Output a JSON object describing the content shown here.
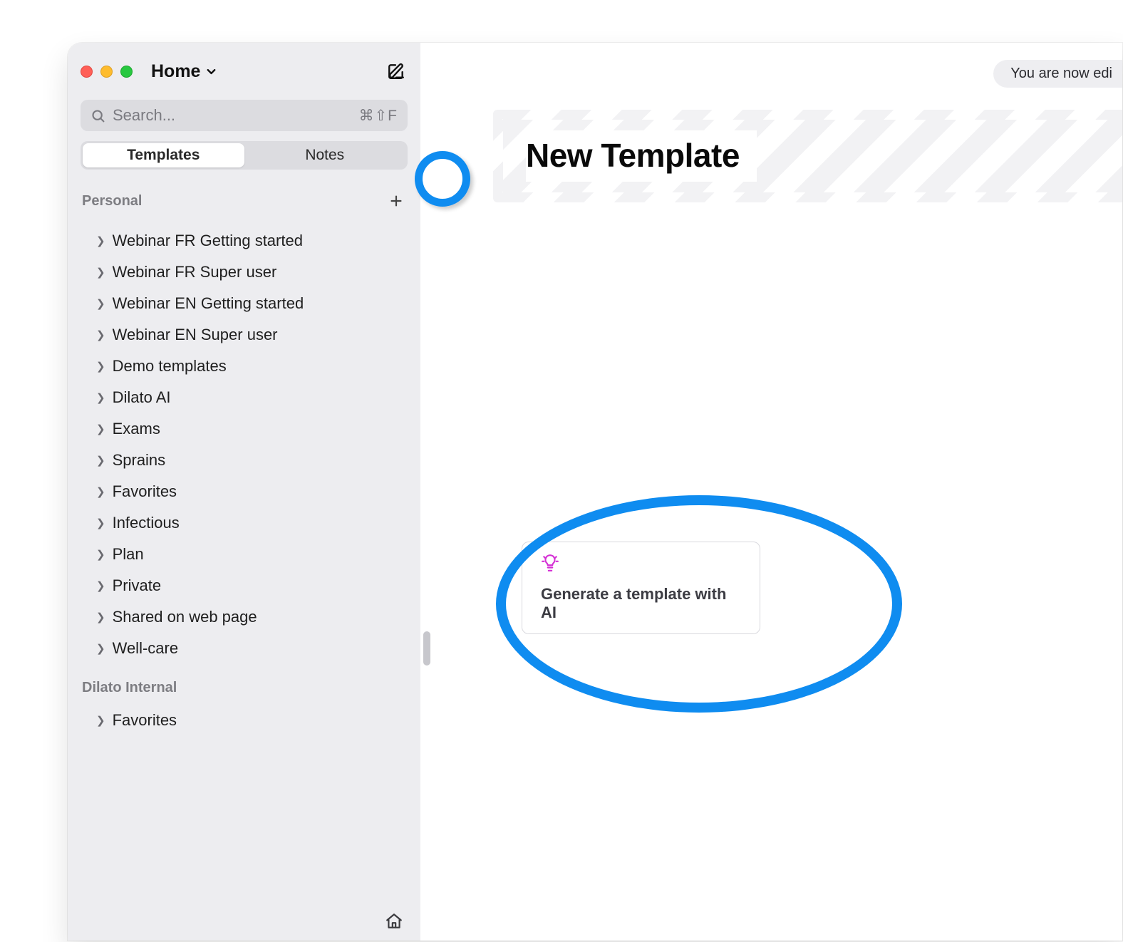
{
  "window": {
    "workspace": "Home",
    "search_placeholder": "Search...",
    "search_shortcut": "⌘⇧F"
  },
  "tabs": {
    "left": "Templates",
    "right": "Notes"
  },
  "sections": {
    "personal": {
      "header": "Personal",
      "items": [
        "Webinar FR Getting started",
        "Webinar FR Super user",
        "Webinar EN Getting started",
        "Webinar EN Super user",
        "Demo templates",
        "Dilato AI",
        "Exams",
        "Sprains",
        "Favorites",
        "Infectious",
        "Plan",
        "Private",
        "Shared on web page",
        "Well-care"
      ]
    },
    "internal": {
      "header": "Dilato Internal",
      "items": [
        "Favorites"
      ]
    }
  },
  "banner": {
    "text": "You are now edi"
  },
  "editor": {
    "title": "New Template"
  },
  "ai_card": {
    "label": "Generate a template with AI"
  }
}
